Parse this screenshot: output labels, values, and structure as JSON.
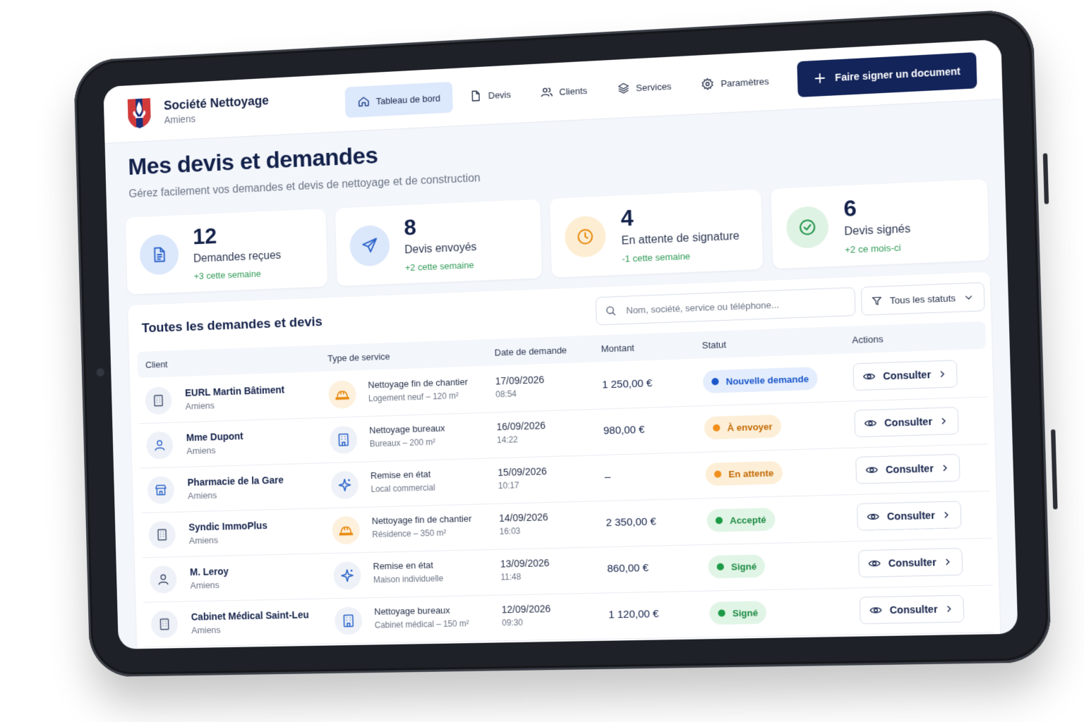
{
  "brand": {
    "name": "Société Nettoyage",
    "city": "Amiens"
  },
  "nav": [
    {
      "label": "Tableau de bord",
      "icon": "home-icon",
      "active": true
    },
    {
      "label": "Devis",
      "icon": "document-icon",
      "active": false
    },
    {
      "label": "Clients",
      "icon": "users-icon",
      "active": false
    },
    {
      "label": "Services",
      "icon": "layers-icon",
      "active": false
    },
    {
      "label": "Paramètres",
      "icon": "gear-icon",
      "active": false
    }
  ],
  "cta_label": "Faire signer un document",
  "page": {
    "title": "Mes devis et demandes",
    "subtitle": "Gérez facilement vos demandes et devis de nettoyage et de construction"
  },
  "stats": [
    {
      "value": "12",
      "label": "Demandes reçues",
      "delta": "+3 cette semaine",
      "icon": "file-icon",
      "color": "#dbe7fb",
      "accent": "#2a62c9"
    },
    {
      "value": "8",
      "label": "Devis envoyés",
      "delta": "+2 cette semaine",
      "icon": "send-icon",
      "color": "#dbe7fb",
      "accent": "#2a62c9"
    },
    {
      "value": "4",
      "label": "En attente de signature",
      "delta": "-1 cette semaine",
      "icon": "clock-icon",
      "color": "#fdeed3",
      "accent": "#e8890f"
    },
    {
      "value": "6",
      "label": "Devis signés",
      "delta": "+2 ce mois-ci",
      "icon": "check-circle-icon",
      "color": "#dff3e4",
      "accent": "#23944a"
    }
  ],
  "table": {
    "title": "Toutes les demandes et devis",
    "search_placeholder": "Nom, société, service ou téléphone...",
    "filter_label": "Tous les statuts",
    "columns": [
      "Client",
      "Type de service",
      "Date de demande",
      "Montant",
      "Statut",
      "Actions"
    ],
    "action_label": "Consulter",
    "rows": [
      {
        "client": "EURL Martin Bâtiment",
        "city": "Amiens",
        "client_icon": "building-icon",
        "service": "Nettoyage fin de chantier",
        "service_sub": "Logement neuf – 120 m²",
        "service_icon": "helmet-icon",
        "date": "17/09/2026",
        "time": "08:54",
        "amount": "1 250,00 €",
        "status": "Nouvelle demande",
        "status_color": "blue"
      },
      {
        "client": "Mme Dupont",
        "city": "Amiens",
        "client_icon": "user-icon",
        "service": "Nettoyage bureaux",
        "service_sub": "Bureaux – 200 m²",
        "service_icon": "office-icon",
        "date": "16/09/2026",
        "time": "14:22",
        "amount": "980,00 €",
        "status": "À envoyer",
        "status_color": "orange"
      },
      {
        "client": "Pharmacie de la Gare",
        "city": "Amiens",
        "client_icon": "store-icon",
        "service": "Remise en état",
        "service_sub": "Local commercial",
        "service_icon": "sparkle-icon",
        "date": "15/09/2026",
        "time": "10:17",
        "amount": "–",
        "status": "En attente",
        "status_color": "orange"
      },
      {
        "client": "Syndic ImmoPlus",
        "city": "Amiens",
        "client_icon": "building-icon",
        "service": "Nettoyage fin de chantier",
        "service_sub": "Résidence – 350 m²",
        "service_icon": "helmet-icon",
        "date": "14/09/2026",
        "time": "16:03",
        "amount": "2 350,00 €",
        "status": "Accepté",
        "status_color": "green"
      },
      {
        "client": "M. Leroy",
        "city": "Amiens",
        "client_icon": "user-icon",
        "service": "Remise en état",
        "service_sub": "Maison individuelle",
        "service_icon": "sparkle-icon",
        "date": "13/09/2026",
        "time": "11:48",
        "amount": "860,00 €",
        "status": "Signé",
        "status_color": "green"
      },
      {
        "client": "Cabinet Médical Saint-Leu",
        "city": "Amiens",
        "client_icon": "building-icon",
        "service": "Nettoyage bureaux",
        "service_sub": "Cabinet médical – 150 m²",
        "service_icon": "office-icon",
        "date": "12/09/2026",
        "time": "09:30",
        "amount": "1 120,00 €",
        "status": "Signé",
        "status_color": "green"
      }
    ]
  }
}
